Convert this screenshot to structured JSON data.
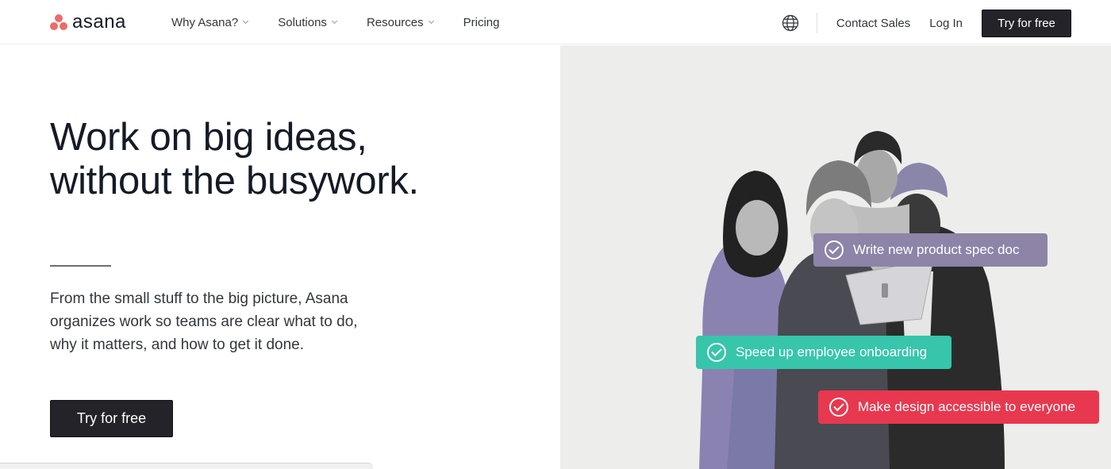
{
  "brand": {
    "name": "asana",
    "accent": "#f06a6a"
  },
  "nav": {
    "links": [
      {
        "label": "Why Asana?",
        "dropdown": true
      },
      {
        "label": "Solutions",
        "dropdown": true
      },
      {
        "label": "Resources",
        "dropdown": true
      },
      {
        "label": "Pricing",
        "dropdown": false
      }
    ],
    "globe_icon": "globe-icon",
    "contact_sales": "Contact Sales",
    "log_in": "Log In",
    "try_free": "Try for free"
  },
  "hero": {
    "headline_line1": "Work on big ideas,",
    "headline_line2": "without the busywork.",
    "subtext": "From the small stuff to the big picture, Asana organizes work so teams are clear what to do, why it matters, and how to get it done.",
    "cta": "Try for free"
  },
  "tasks": [
    {
      "label": "Write new product spec doc",
      "color": "#8d84a8"
    },
    {
      "label": "Speed up employee onboarding",
      "color": "#37c5ab"
    },
    {
      "label": "Make design accessible to everyone",
      "color": "#e8384f"
    }
  ]
}
